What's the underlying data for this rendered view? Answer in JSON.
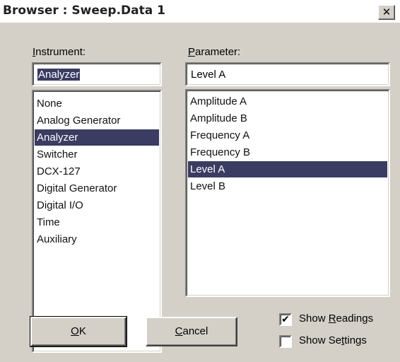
{
  "window": {
    "title": "Browser : Sweep.Data 1",
    "close_icon": "close-icon"
  },
  "instrument": {
    "label_prefix": "",
    "label_accel": "I",
    "label_rest": "nstrument:",
    "field_value": "Analyzer",
    "items": [
      "None",
      "Analog Generator",
      "Analyzer",
      "Switcher",
      "DCX-127",
      "Digital Generator",
      "Digital I/O",
      "Time",
      "Auxiliary"
    ],
    "selected": "Analyzer"
  },
  "parameter": {
    "label_accel": "P",
    "label_rest": "arameter:",
    "field_value": "Level A",
    "items": [
      "Amplitude A",
      "Amplitude B",
      "Frequency A",
      "Frequency B",
      "Level A",
      "Level B"
    ],
    "selected": "Level A"
  },
  "buttons": {
    "ok_accel": "O",
    "ok_rest": "K",
    "cancel_accel": "C",
    "cancel_rest": "ancel"
  },
  "options": {
    "show_readings_pre": "Show ",
    "show_readings_accel": "R",
    "show_readings_post": "eadings",
    "show_readings_checked": true,
    "show_settings_pre": "Show Se",
    "show_settings_accel": "t",
    "show_settings_post": "tings",
    "show_settings_checked": false
  },
  "colors": {
    "selection": "#3a3c62",
    "dialog_bg": "#d4d0c8"
  }
}
